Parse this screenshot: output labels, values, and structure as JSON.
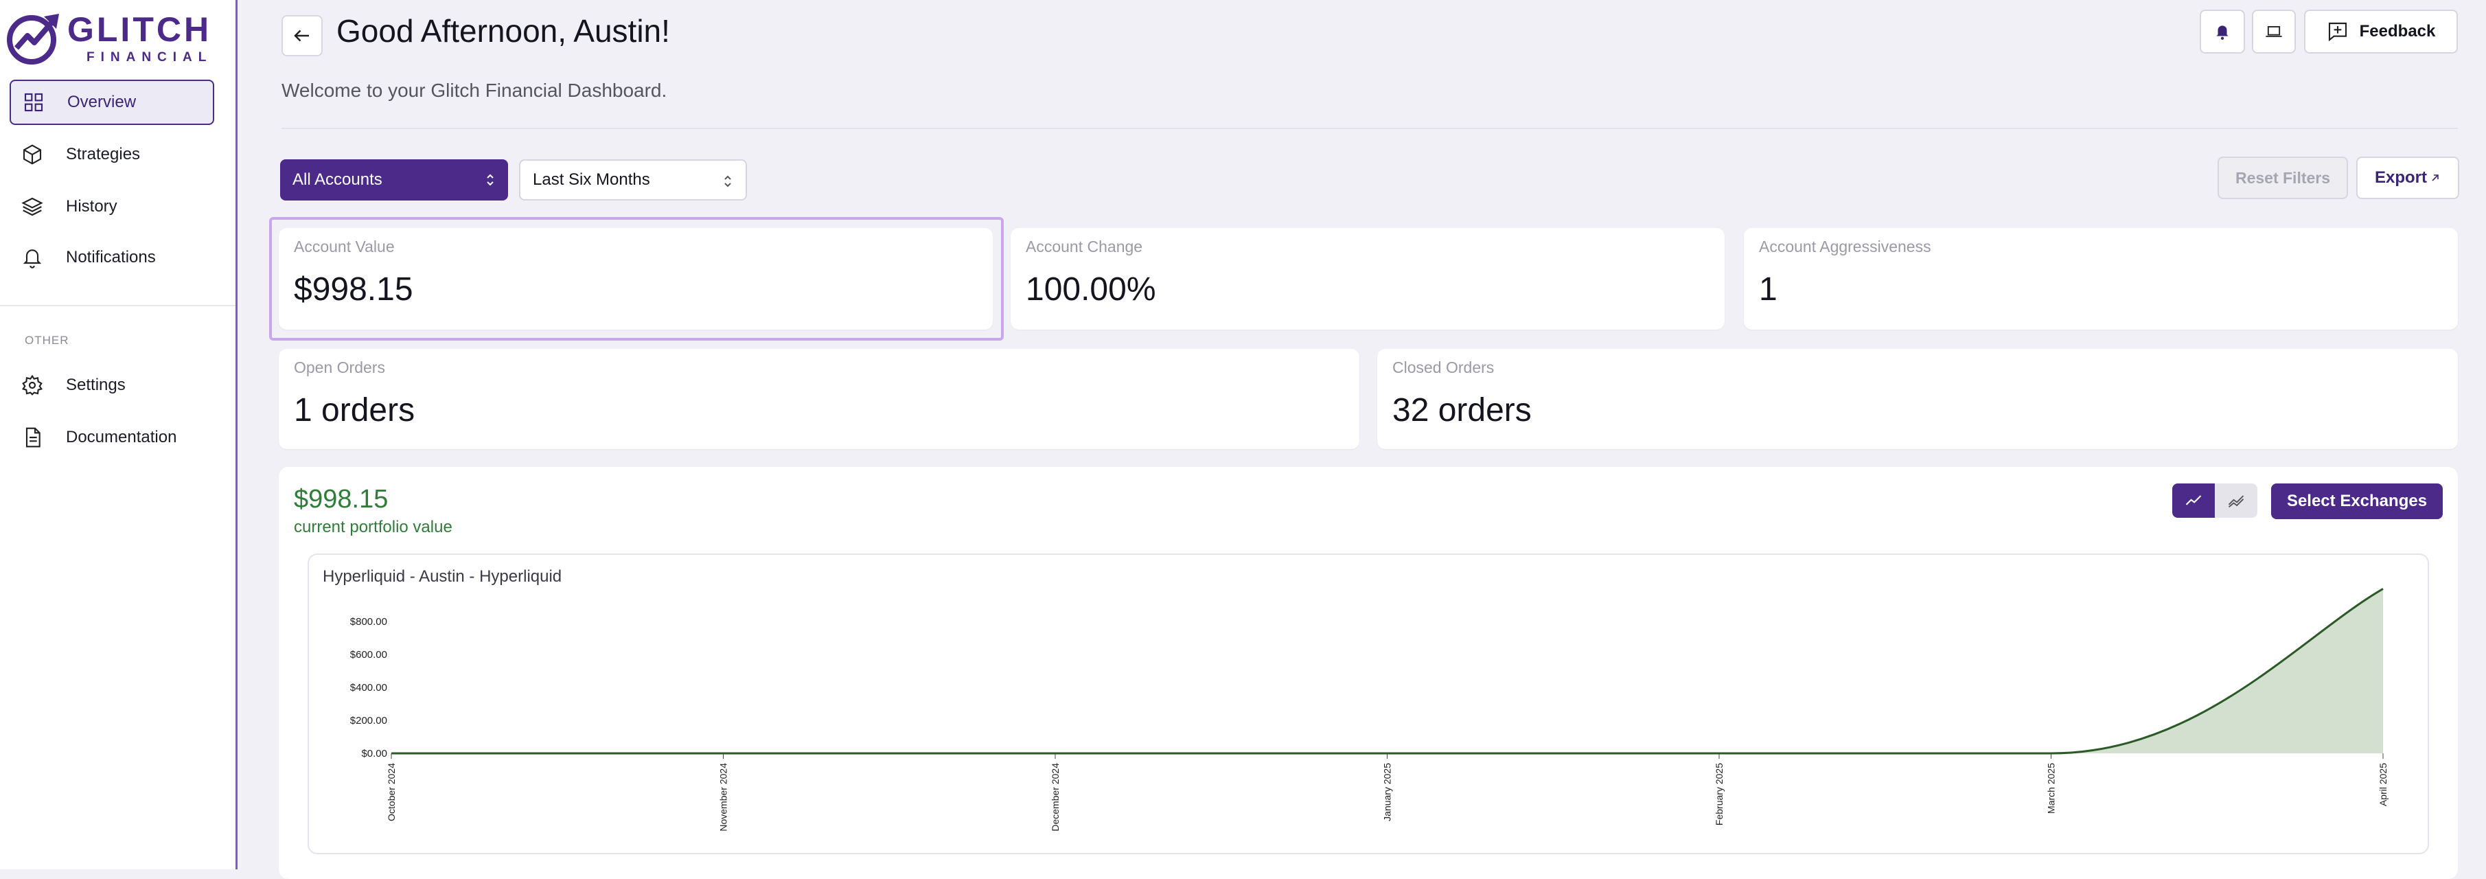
{
  "app": {
    "logo_line1": "GLITCH",
    "logo_line2": "FINANCIAL",
    "brand_color": "#4b2a8a"
  },
  "sidebar": {
    "items": [
      {
        "label": "Overview",
        "icon": "grid-icon"
      },
      {
        "label": "Strategies",
        "icon": "cube-icon"
      },
      {
        "label": "History",
        "icon": "layers-icon"
      },
      {
        "label": "Notifications",
        "icon": "bell-icon"
      }
    ],
    "section_label": "OTHER",
    "other_items": [
      {
        "label": "Settings",
        "icon": "gear-icon"
      },
      {
        "label": "Documentation",
        "icon": "document-icon"
      }
    ]
  },
  "header": {
    "greeting": "Good Afternoon, Austin!",
    "welcome": "Welcome to your Glitch Financial Dashboard.",
    "feedback_label": "Feedback"
  },
  "filters": {
    "account_select": "All Accounts",
    "period_select": "Last Six Months",
    "reset_label": "Reset Filters",
    "export_label": "Export"
  },
  "stats": {
    "account_value": {
      "label": "Account Value",
      "value": "$998.15"
    },
    "account_change": {
      "label": "Account Change",
      "value": "100.00%"
    },
    "account_aggressiveness": {
      "label": "Account Aggressiveness",
      "value": "1"
    },
    "open_orders": {
      "label": "Open Orders",
      "value": "1 orders"
    },
    "closed_orders": {
      "label": "Closed Orders",
      "value": "32 orders"
    }
  },
  "portfolio": {
    "value": "$998.15",
    "label": "current portfolio value",
    "select_exchanges_label": "Select Exchanges",
    "accent_color": "#2f7d38"
  },
  "chart_data": {
    "type": "area",
    "title": "Hyperliquid - Austin - Hyperliquid",
    "x": [
      "October 2024",
      "November 2024",
      "December 2024",
      "January 2025",
      "February 2025",
      "March 2025",
      "April 2025"
    ],
    "series": [
      {
        "values": [
          0,
          0,
          0,
          0,
          0,
          0,
          998.15
        ]
      }
    ],
    "y_ticks": [
      "$0.00",
      "$200.00",
      "$400.00",
      "$600.00",
      "$800.00"
    ],
    "ylim": [
      0,
      1000
    ],
    "grid": false,
    "line_color": "#2c5a26",
    "fill_color": "#d3e0d0"
  }
}
